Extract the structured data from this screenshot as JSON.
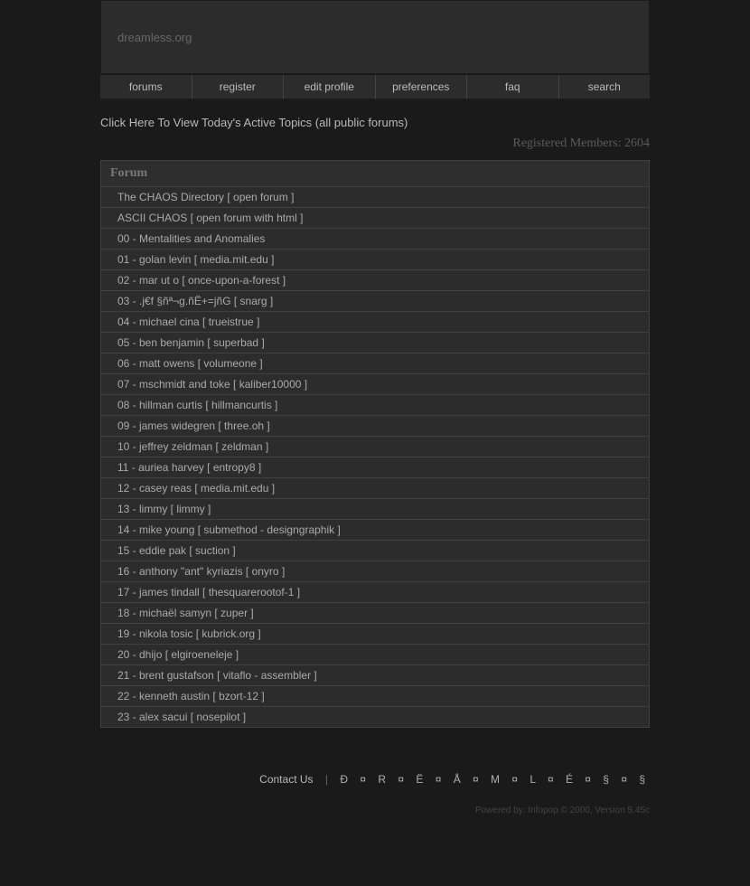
{
  "site_title": "dreamless.org",
  "nav": [
    "forums",
    "register",
    "edit profile",
    "preferences",
    "faq",
    "search"
  ],
  "topics_link": "Click Here To View Today's Active Topics (all public forums)",
  "members_label": "Registered Members: 2604",
  "forum_header": "Forum",
  "forums": [
    "The CHAOS Directory [ open forum ]",
    "ASCII CHAOS [ open forum with html ]",
    "00 - Mentalities and Anomalies",
    "01 - golan levin [ media.mit.edu ]",
    "02 - mar ut o [ once-upon-a-forest ]",
    "03 - .j€f §ñª¬g.ñË+=jñG [ snarg ]",
    "04 - michael cina [ trueistrue ]",
    "05 - ben benjamin [ superbad ]",
    "06 - matt owens [ volumeone ]",
    "07 - mschmidt and toke [ kaliber10000 ]",
    "08 - hillman curtis [ hillmancurtis ]",
    "09 - james widegren [ three.oh ]",
    "10 - jeffrey zeldman [ zeldman ]",
    "11 - auriea harvey [ entropy8 ]",
    "12 - casey reas [ media.mit.edu ]",
    "13 - limmy [ limmy ]",
    "14 - mike young [ submethod - designgraphik ]",
    "15 - eddie pak [ suction ]",
    "16 - anthony \"ant\" kyriazis [ onyro ]",
    "17 - james tindall [ thesquarerootof-1 ]",
    "18 - michaël samyn [ zuper ]",
    "19 - nikola tosic [ kubrick.org ]",
    "20 - dhijo [ elgiroeneleje ]",
    "21 - brent gustafson [ vitaflo - assembler ]",
    "22 - kenneth austin [ bzort-12 ]",
    "23 - alex sacui [ nosepilot ]"
  ],
  "footer": {
    "contact": "Contact Us",
    "separator": "|",
    "stylized": "Ð ¤ R ¤ Ë ¤ Å ¤ M ¤ L ¤ É ¤ § ¤ §"
  },
  "powered": "Powered by: Infopop © 2000, Version 5.45c"
}
